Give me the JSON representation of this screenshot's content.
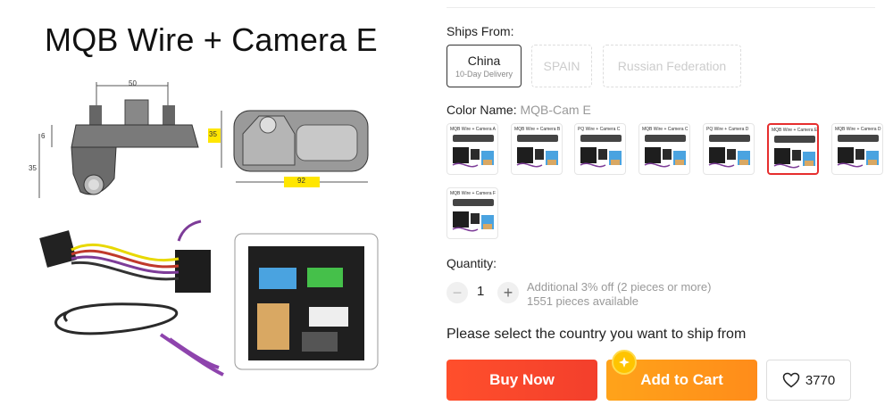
{
  "product_image": {
    "title": "MQB Wire + Camera E",
    "dim_top": "50",
    "dim_left_small": "6",
    "dim_left_large": "35",
    "dim_right_height": "35",
    "dim_bottom_width": "92"
  },
  "ships_from": {
    "label": "Ships From:",
    "options": [
      {
        "name": "China",
        "note": "10-Day Delivery"
      },
      {
        "name": "SPAIN"
      },
      {
        "name": "Russian Federation"
      }
    ]
  },
  "color": {
    "label": "Color Name:",
    "selected": "MQB-Cam E",
    "options": [
      "MQB Wire + Camera A",
      "MQB Wire + Camera B",
      "PQ Wire + Camera C",
      "MQB Wire + Camera C",
      "PQ Wire + Camera D",
      "MQB Wire + Camera E",
      "MQB Wire + Camera D",
      "MQB Wire + Camera F"
    ],
    "selected_index": 5
  },
  "quantity": {
    "label": "Quantity:",
    "value": "1",
    "minus": "−",
    "plus": "+",
    "discount": "Additional 3% off (2 pieces or more)",
    "available": "1551 pieces available"
  },
  "shipping_message": "Please select the country you want to ship from",
  "actions": {
    "buy_now": "Buy Now",
    "add_to_cart": "Add to Cart",
    "wishlist_count": "3770"
  },
  "colors": {
    "buy_now": "#f33f2c",
    "add_to_cart": "#ff8c1a",
    "selected_border": "#e62e2e"
  }
}
